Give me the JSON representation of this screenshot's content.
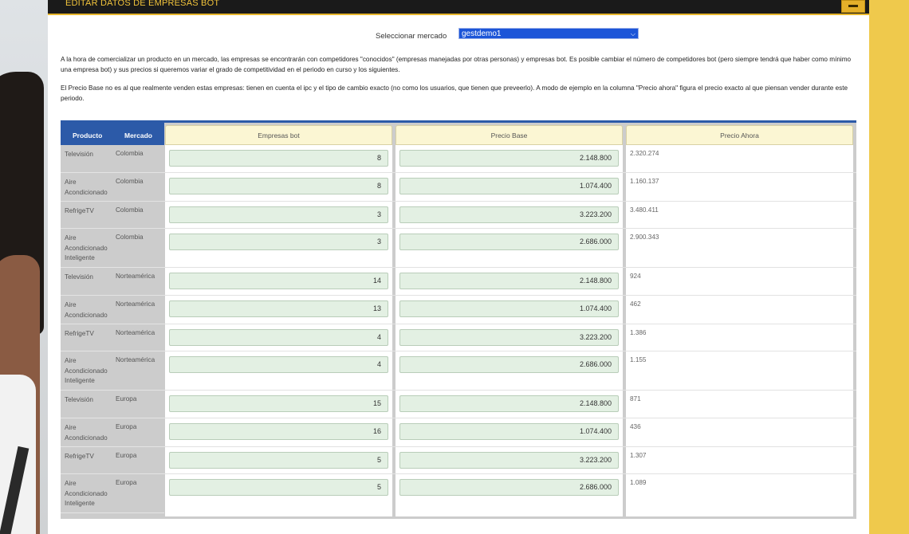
{
  "header": {
    "title": "EDITAR DATOS DE EMPRESAS BOT"
  },
  "market": {
    "label": "Seleccionar mercado",
    "selected": "gestdemo1"
  },
  "paragraphs": {
    "p1": "A la hora de comercializar un producto en un mercado, las empresas se encontrarán con competidores \"conocidos\" (empresas manejadas por otras personas) y empresas bot. Es posible cambiar el número de competidores bot (pero siempre tendrá que haber como mínimo una empresa bot) y sus precios si queremos variar el grado de competitividad en el periodo en curso y los siguientes.",
    "p2": "El Precio Base no es al que realmente venden estas empresas: tienen en cuenta el ipc y el tipo de cambio exacto (no como los usuarios, que tienen que preveerlo). A modo de ejemplo en la columna \"Precio ahora\" figura el precio exacto al que piensan vender durante este periodo."
  },
  "table": {
    "headers": {
      "producto": "Producto",
      "mercado": "Mercado",
      "empresas": "Empresas bot",
      "precio_base": "Precio Base",
      "precio_ahora": "Precio Ahora"
    },
    "rows": [
      {
        "producto": "Televisión",
        "mercado": "Colombia",
        "empresas": "8",
        "precio_base": "2.148.800",
        "precio_ahora": "2.320.274"
      },
      {
        "producto": "Aire Acondicionado",
        "mercado": "Colombia",
        "empresas": "8",
        "precio_base": "1.074.400",
        "precio_ahora": "1.160.137"
      },
      {
        "producto": "RefrigeTV",
        "mercado": "Colombia",
        "empresas": "3",
        "precio_base": "3.223.200",
        "precio_ahora": "3.480.411"
      },
      {
        "producto": "Aire Acondicionado Inteligente",
        "mercado": "Colombia",
        "empresas": "3",
        "precio_base": "2.686.000",
        "precio_ahora": "2.900.343"
      },
      {
        "producto": "Televisión",
        "mercado": "Norteamérica",
        "empresas": "14",
        "precio_base": "2.148.800",
        "precio_ahora": "924"
      },
      {
        "producto": "Aire Acondicionado",
        "mercado": "Norteamérica",
        "empresas": "13",
        "precio_base": "1.074.400",
        "precio_ahora": "462"
      },
      {
        "producto": "RefrigeTV",
        "mercado": "Norteamérica",
        "empresas": "4",
        "precio_base": "3.223.200",
        "precio_ahora": "1.386"
      },
      {
        "producto": "Aire Acondicionado Inteligente",
        "mercado": "Norteamérica",
        "empresas": "4",
        "precio_base": "2.686.000",
        "precio_ahora": "1.155"
      },
      {
        "producto": "Televisión",
        "mercado": "Europa",
        "empresas": "15",
        "precio_base": "2.148.800",
        "precio_ahora": "871"
      },
      {
        "producto": "Aire Acondicionado",
        "mercado": "Europa",
        "empresas": "16",
        "precio_base": "1.074.400",
        "precio_ahora": "436"
      },
      {
        "producto": "RefrigeTV",
        "mercado": "Europa",
        "empresas": "5",
        "precio_base": "3.223.200",
        "precio_ahora": "1.307"
      },
      {
        "producto": "Aire Acondicionado Inteligente",
        "mercado": "Europa",
        "empresas": "5",
        "precio_base": "2.686.000",
        "precio_ahora": "1.089"
      }
    ]
  },
  "colors": {
    "accent_yellow": "#efc94c",
    "header_blue": "#2c5aa8",
    "select_blue": "#1c55d8",
    "input_green": "#e3f0e3",
    "column_header_cream": "#fbf6d3"
  }
}
